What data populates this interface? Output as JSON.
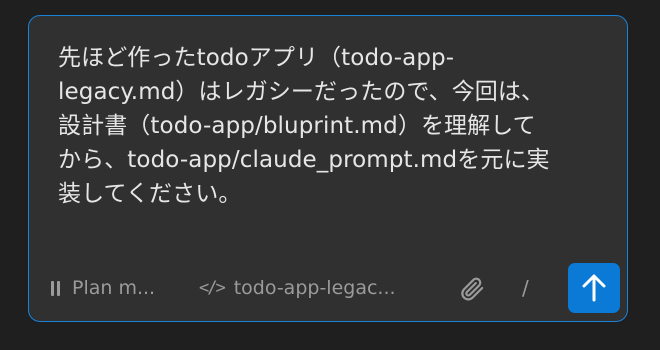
{
  "prompt": {
    "text": "先ほど作ったtodoアプリ（todo-app-\nlegacy.md）はレガシーだったので、今回は、\n設計書（todo-app/bluprint.md）を理解して\nから、todo-app/claude_prompt.mdを元に実\n装してください。"
  },
  "footer": {
    "mode_label": "Plan m...",
    "file_label": "todo-app-legac...",
    "code_icon_glyph": "</>",
    "slash_label": "/",
    "pause_icon": "pause-icon",
    "attach_icon": "paperclip-icon",
    "send_icon": "arrow-up-icon"
  },
  "colors": {
    "background": "#1f1f1f",
    "composer_bg": "#303030",
    "focus_border": "#1a82d6",
    "send_button": "#0a7ad6",
    "muted_text": "#9b9b9b",
    "text": "#e6e6e6"
  }
}
